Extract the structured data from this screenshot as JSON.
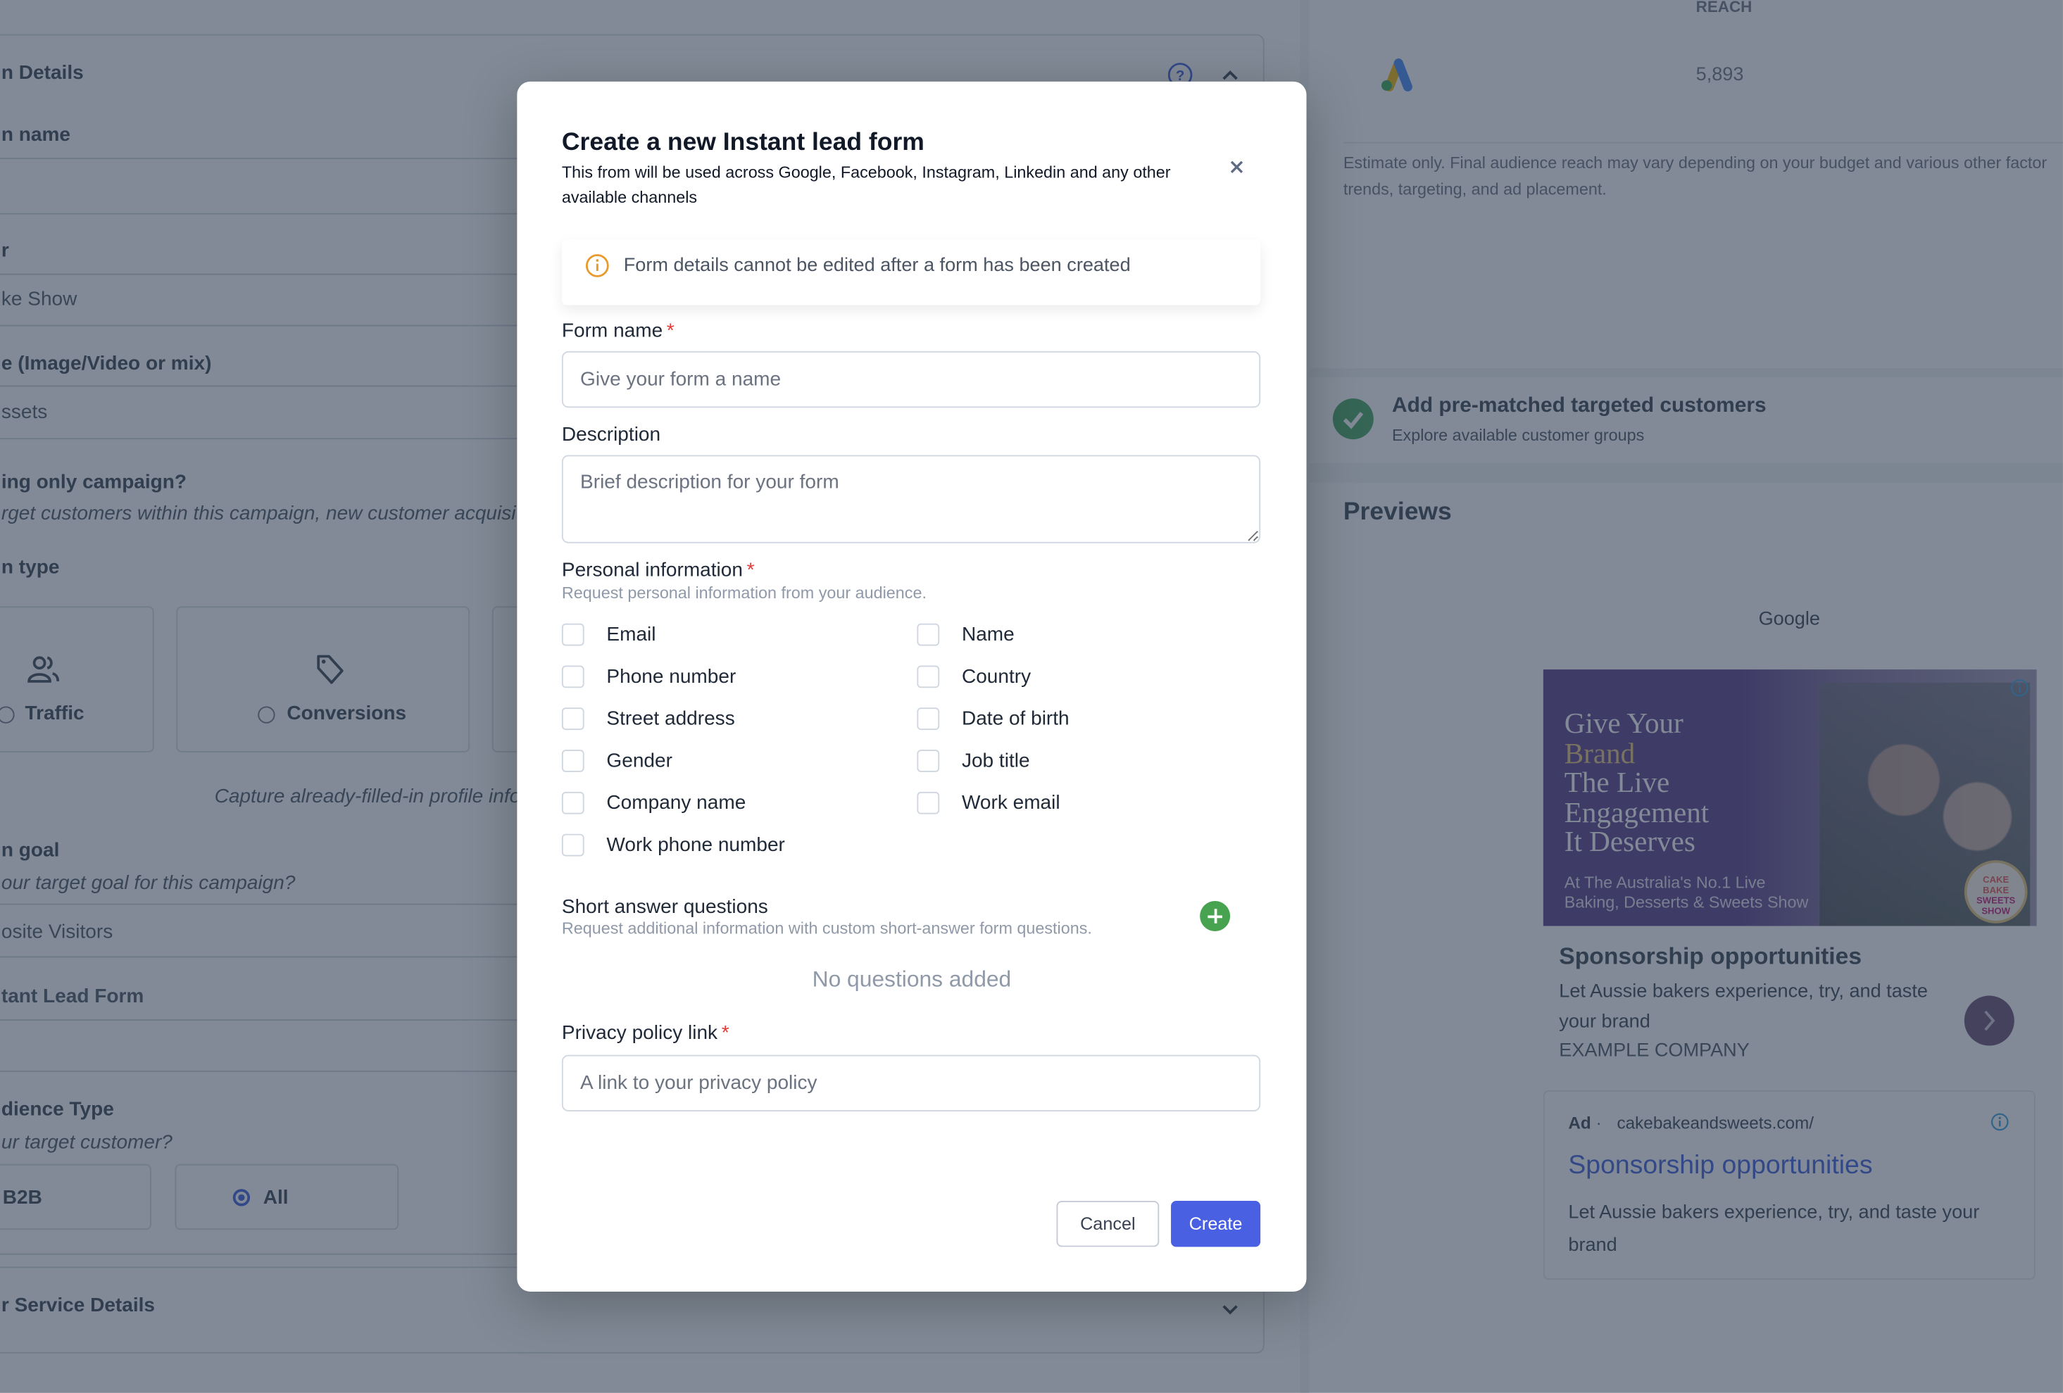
{
  "background": {
    "left": {
      "section_title": "n Details",
      "fields": [
        {
          "label": "n name",
          "value": ""
        },
        {
          "label": "r",
          "value": "ke Show"
        },
        {
          "label": "e (Image/Video or mix)",
          "value": "ssets"
        }
      ],
      "question": {
        "label": "ing only campaign?",
        "hint": "rget customers within this campaign, new customer acquisi"
      },
      "campaign_type": {
        "label": "n type",
        "options": [
          {
            "label": "Traffic",
            "icon": "users-icon",
            "selected": false
          },
          {
            "label": "Conversions",
            "icon": "tag-icon",
            "selected": false
          }
        ],
        "hint": "Capture already-filled-in profile info"
      },
      "goal": {
        "label": "n goal",
        "hint": "our target goal for this campaign?",
        "value": "osite Visitors",
        "value2": "tant Lead Form"
      },
      "audience": {
        "label": "dience Type",
        "hint": "ur target customer?",
        "options": [
          {
            "label": "B2B",
            "selected": false
          },
          {
            "label": "All",
            "selected": true
          }
        ]
      },
      "collapsed_section": "r Service Details",
      "help_icon_label": "?"
    },
    "right": {
      "reach_header": "REACH",
      "reach_value": "5,893",
      "disclaimer": "Estimate only. Final audience reach may vary depending on your budget and various other factor trends, targeting, and ad placement.",
      "prematched": {
        "title": "Add pre-matched targeted customers",
        "subtitle": "Explore available customer groups"
      },
      "previews_title": "Previews",
      "platform": "Google",
      "display_ad": {
        "headline_lines": [
          "Give Your",
          "Brand",
          "The Live",
          "Engagement",
          "It Deserves"
        ],
        "tagline_lines": [
          "At The Australia's No.1 Live",
          "Baking, Desserts & Sweets Show"
        ],
        "logo_lines": [
          "CAKE",
          "BAKE",
          "SWEETS",
          "SHOW"
        ],
        "title": "Sponsorship opportunities",
        "description": "Let Aussie bakers experience, try, and taste your brand",
        "company": "EXAMPLE COMPANY"
      },
      "search_ad": {
        "badge": "Ad",
        "separator": "·",
        "url": "cakebakeandsweets.com/",
        "title": "Sponsorship opportunities",
        "description": "Let Aussie bakers experience, try, and taste your brand"
      }
    }
  },
  "modal": {
    "title": "Create a new Instant lead form",
    "subtitle": "This from will be used across Google, Facebook, Instagram, Linkedin and any other available channels",
    "alert": "Form details cannot be edited after a form has been created",
    "form_name": {
      "label": "Form name",
      "required": "*",
      "placeholder": "Give your form a name",
      "value": ""
    },
    "description": {
      "label": "Description",
      "placeholder": "Brief description for your form",
      "value": ""
    },
    "personal_info": {
      "label": "Personal information",
      "required": "*",
      "hint": "Request personal information from your audience.",
      "options": [
        {
          "label": "Email",
          "checked": false
        },
        {
          "label": "Name",
          "checked": false
        },
        {
          "label": "Phone number",
          "checked": false
        },
        {
          "label": "Country",
          "checked": false
        },
        {
          "label": "Street address",
          "checked": false
        },
        {
          "label": "Date of birth",
          "checked": false
        },
        {
          "label": "Gender",
          "checked": false
        },
        {
          "label": "Job title",
          "checked": false
        },
        {
          "label": "Company name",
          "checked": false
        },
        {
          "label": "Work email",
          "checked": false
        },
        {
          "label": "Work phone number",
          "checked": false
        }
      ]
    },
    "short_answer": {
      "label": "Short answer questions",
      "hint": "Request additional information with custom short-answer form questions.",
      "empty": "No questions added"
    },
    "privacy": {
      "label": "Privacy policy link",
      "required": "*",
      "placeholder": "A link to your privacy policy",
      "value": ""
    },
    "cancel_label": "Cancel",
    "create_label": "Create"
  },
  "colors": {
    "primary": "#4a60e2",
    "add_green": "#47a350",
    "required_red": "#e53935",
    "alert_orange": "#e89a2c",
    "overlay": "rgba(45,60,80,0.6)"
  }
}
